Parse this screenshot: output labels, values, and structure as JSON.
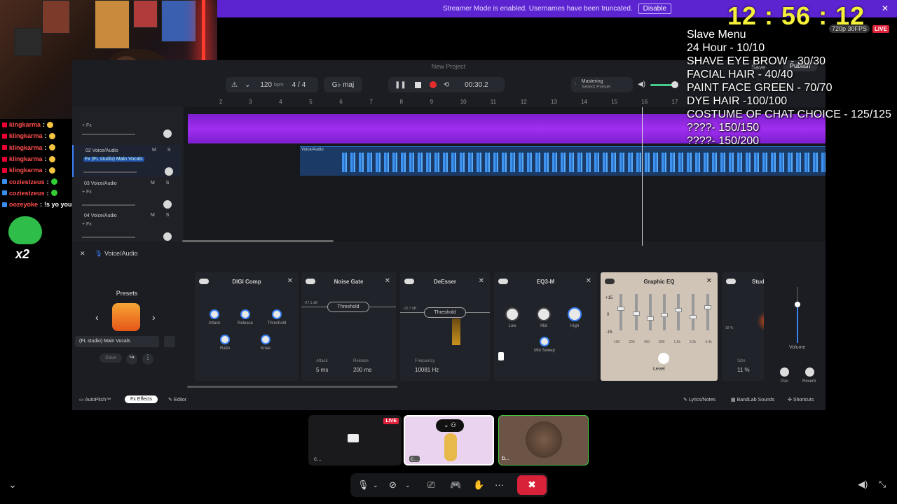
{
  "stream": {
    "banner": {
      "text": "Streamer Mode is enabled. Usernames have been truncated.",
      "disable_label": "Disable"
    },
    "clock": "12 : 56 : 12",
    "quality": "720p 30FPS",
    "live_badge": "LIVE",
    "menu": {
      "title": "Slave Menu",
      "items": [
        "24 Hour - 10/10",
        "SHAVE EYE BROW - 30/30",
        "FACIAL HAIR - 40/40",
        "PAINT FACE GREEN - 70/70",
        "DYE HAIR -100/100",
        "COSTUME OF CHAT CHOICE - 125/125",
        "????- 150/150",
        "????- 150/200"
      ]
    },
    "chat": [
      {
        "user": "kingkarma",
        "msg": ""
      },
      {
        "user": "klingkarma",
        "msg": ""
      },
      {
        "user": "klingkarma",
        "msg": ""
      },
      {
        "user": "klingkarma",
        "msg": ""
      },
      {
        "user": "klingkarma",
        "msg": ""
      },
      {
        "user": "coziestzeus",
        "msg": ""
      },
      {
        "user": "coziestzeus",
        "msg": ""
      },
      {
        "user": "oozeyoke",
        "msg": "!s yo you got any tree"
      }
    ],
    "emote_multiplier": "x2"
  },
  "daw": {
    "project_title": "New Project",
    "bpm": "120",
    "bpm_unit": "bpm",
    "time_sig": "4 / 4",
    "key": "G♭ maj",
    "time": "00:30.2",
    "mastering": "Mastering",
    "mastering_sub": "Select Preset",
    "save": "Save",
    "publish": "Publish",
    "ruler": [
      "2",
      "3",
      "4",
      "5",
      "6",
      "7",
      "8",
      "9",
      "10",
      "11",
      "12",
      "13",
      "14",
      "15",
      "16",
      "17"
    ],
    "tracks": [
      {
        "name": "",
        "fx": "+ Fx"
      },
      {
        "name": "02  Voice/Audio",
        "fx": "Fx  (FL studio) Main Vocals"
      },
      {
        "name": "03  Voice/Audio",
        "fx": "+ Fx"
      },
      {
        "name": "04  Voice/Audio",
        "fx": "+ Fx"
      }
    ],
    "track_btns": "M S",
    "clip_label": "Voice/Audio",
    "fx_panel_title": "Voice/Audio",
    "presets": {
      "label": "Presets",
      "selected": "(FL studio) Main Vocals",
      "save": "Save"
    },
    "plugins": {
      "digi": {
        "title": "DIGI Comp",
        "knobs": [
          "Attack",
          "Release",
          "Threshold",
          "Ratio",
          "Knee"
        ]
      },
      "gate": {
        "title": "Noise Gate",
        "threshold": "Threshold",
        "db": "-27.1 dB",
        "attack_label": "Attack",
        "attack": "5 ms",
        "release_label": "Release",
        "release": "200 ms"
      },
      "desser": {
        "title": "DeEsser",
        "threshold": "Threshold",
        "db": "-12.7 dB",
        "freq_label": "Frequency",
        "freq": "10081 Hz"
      },
      "eq3": {
        "title": "EQ3-M",
        "knobs": [
          "Low",
          "Mid",
          "High",
          "Mid Sweep"
        ]
      },
      "geq": {
        "title": "Graphic EQ",
        "scale": [
          "+15",
          "0",
          "-15"
        ],
        "bands": [
          "100",
          "200",
          "400",
          "800",
          "1.6k",
          "3.2k",
          "6.4k"
        ],
        "level": "Level"
      },
      "studio": {
        "title": "Studi",
        "pct_label": "18 %",
        "size_label": "Size",
        "size": "11 %"
      }
    },
    "volume": "Volume",
    "pan": "Pan",
    "reverb": "Reverb",
    "bottom": {
      "autopitch": "AutoPitch™",
      "effects": "Effects",
      "editor": "Editor",
      "lyrics": "Lyrics/Notes",
      "sounds": "BandLab Sounds",
      "shortcuts": "Shortcuts"
    }
  },
  "call": {
    "thumb1_label": "c...",
    "thumb1_live": "LIVE",
    "thumb2_label": "c...",
    "thumb3_label": "b..."
  }
}
